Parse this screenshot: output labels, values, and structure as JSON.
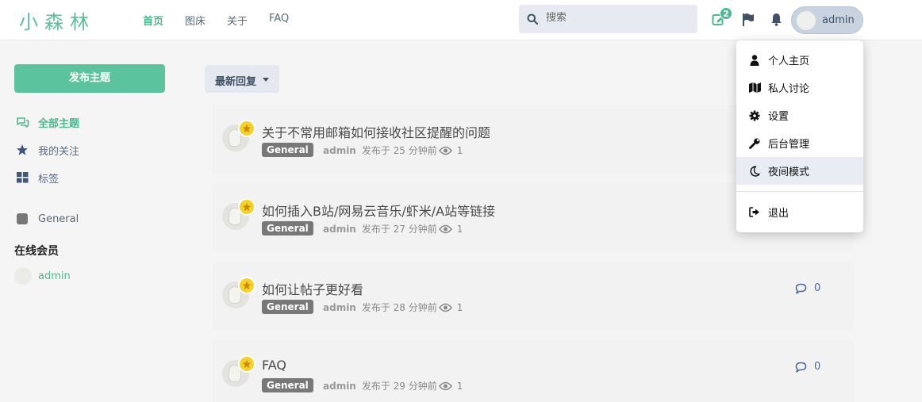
{
  "header": {
    "logo": "小森林",
    "nav": [
      "首页",
      "图床",
      "关于",
      "FAQ"
    ],
    "search_placeholder": "搜索",
    "notification_count": "2",
    "username": "admin"
  },
  "sidebar": {
    "publish_label": "发布主题",
    "items": [
      {
        "label": "全部主题",
        "icon": "comments-icon"
      },
      {
        "label": "我的关注",
        "icon": "star-icon"
      },
      {
        "label": "标签",
        "icon": "grid-icon"
      }
    ],
    "tag": "General",
    "online_title": "在线会员",
    "online_users": [
      "admin"
    ]
  },
  "sort": {
    "label": "最新回复"
  },
  "discussions": [
    {
      "title": "关于不常用邮箱如何接收社区提醒的问题",
      "tag": "General",
      "author": "admin",
      "time": "发布于 25 分钟前",
      "views": "1",
      "replies": ""
    },
    {
      "title": "如何插入B站/网易云音乐/虾米/A站等链接",
      "tag": "General",
      "author": "admin",
      "time": "发布于 27 分钟前",
      "views": "1",
      "replies": ""
    },
    {
      "title": "如何让帖子更好看",
      "tag": "General",
      "author": "admin",
      "time": "发布于 28 分钟前",
      "views": "1",
      "replies": "0"
    },
    {
      "title": "FAQ",
      "tag": "General",
      "author": "admin",
      "time": "发布于 29 分钟前",
      "views": "1",
      "replies": "0"
    }
  ],
  "user_menu": {
    "items": [
      {
        "label": "个人主页",
        "icon": "user-icon"
      },
      {
        "label": "私人讨论",
        "icon": "map-icon"
      },
      {
        "label": "设置",
        "icon": "gear-icon"
      },
      {
        "label": "后台管理",
        "icon": "wrench-icon"
      },
      {
        "label": "夜间模式",
        "icon": "moon-icon"
      }
    ],
    "logout": "退出"
  },
  "colors": {
    "accent": "#4eb88f",
    "publish": "#5bc49f",
    "tag": "#787878",
    "star": "#f6d12a"
  }
}
